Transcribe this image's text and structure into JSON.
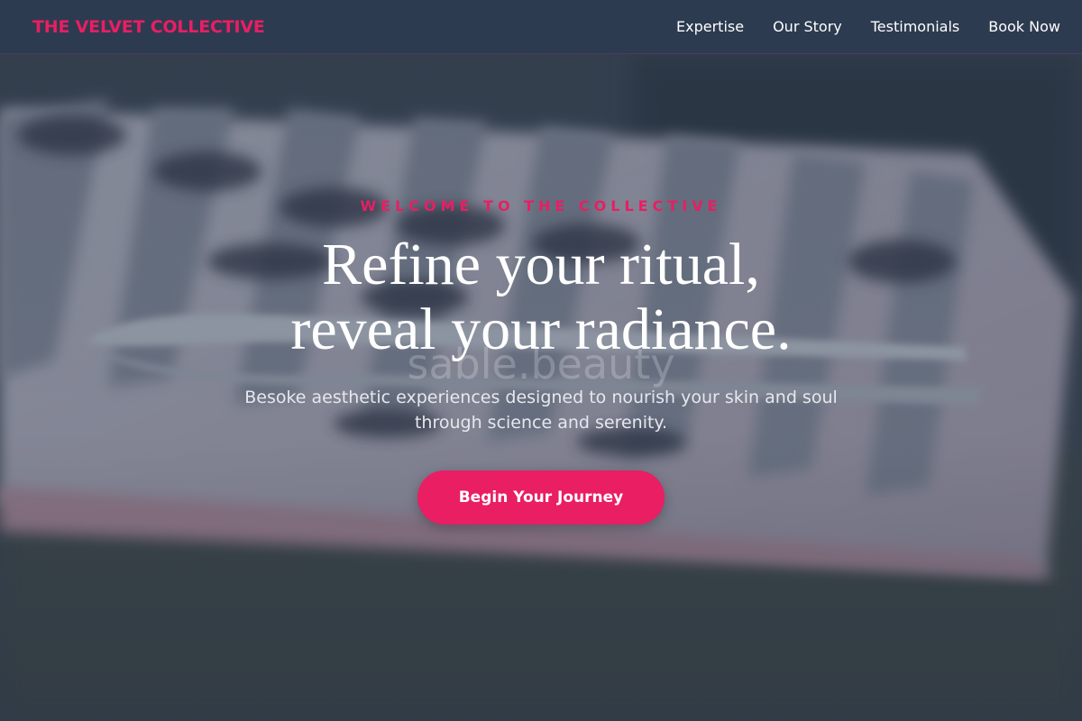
{
  "header": {
    "brand": "THE VELVET COLLECTIVE",
    "nav": [
      {
        "label": "Expertise"
      },
      {
        "label": "Our Story"
      },
      {
        "label": "Testimonials"
      },
      {
        "label": "Book Now"
      }
    ]
  },
  "hero": {
    "eyebrow": "WELCOME TO THE COLLECTIVE",
    "headline_line1": "Refine your ritual,",
    "headline_line2": "reveal your radiance.",
    "subtext": "Besoke aesthetic experiences designed to nourish your skin and soul through science and serenity.",
    "cta_label": "Begin Your Journey",
    "background_watermark": "sable.beauty"
  },
  "colors": {
    "accent": "#e91e63",
    "header_bg": "#2d3b50",
    "overlay": "#2c384c"
  }
}
